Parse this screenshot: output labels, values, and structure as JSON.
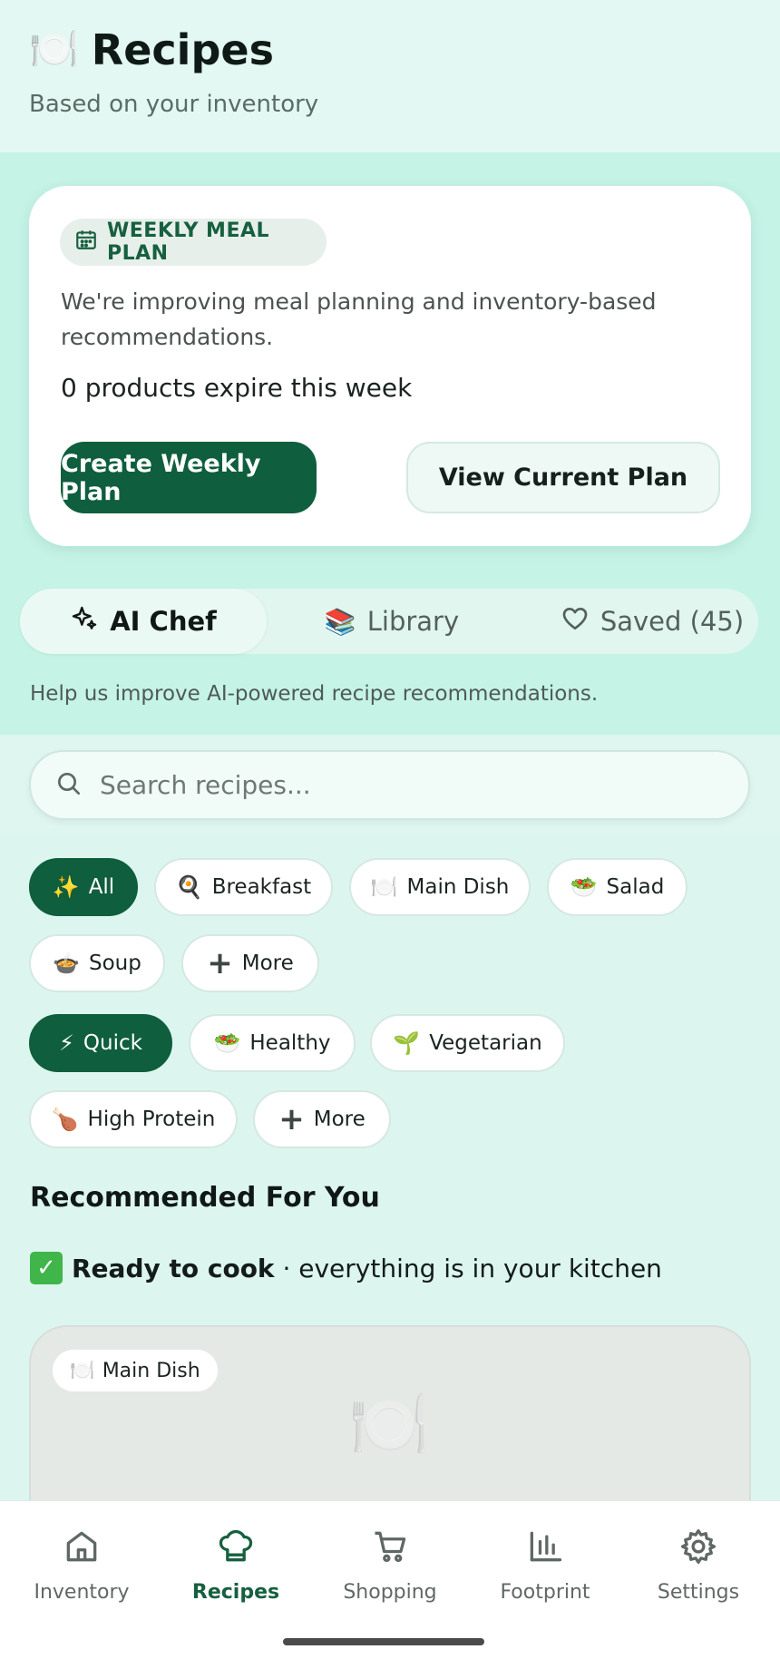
{
  "header": {
    "title": "Recipes",
    "title_icon": "plate-cutlery-icon",
    "subtitle": "Based on your inventory"
  },
  "meal_plan": {
    "badge_label": "WEEKLY MEAL PLAN",
    "badge_icon": "calendar-icon",
    "description": "We're improving meal planning and inventory-based recommendations.",
    "expire_text": "0 products expire this week",
    "create_label": "Create Weekly Plan",
    "view_label": "View Current Plan"
  },
  "tabs": [
    {
      "label": "AI Chef",
      "icon": "sparkle-icon",
      "active": true
    },
    {
      "label": "Library",
      "icon": "books-icon",
      "active": false
    },
    {
      "label": "Saved (45)",
      "icon": "heart-icon",
      "active": false
    }
  ],
  "help_text": "Help us improve AI-powered recipe recommendations.",
  "search": {
    "placeholder": "Search recipes..."
  },
  "category_chips": [
    {
      "label": "All",
      "emoji": "✨",
      "active": true
    },
    {
      "label": "Breakfast",
      "emoji": "🍳",
      "active": false
    },
    {
      "label": "Main Dish",
      "emoji": "🍽️",
      "active": false
    },
    {
      "label": "Salad",
      "emoji": "🥗",
      "active": false
    },
    {
      "label": "Soup",
      "emoji": "🍲",
      "active": false
    },
    {
      "label": "More",
      "emoji": "+",
      "active": false
    }
  ],
  "tag_chips": [
    {
      "label": "Quick",
      "emoji": "⚡",
      "active": true
    },
    {
      "label": "Healthy",
      "emoji": "🥗",
      "active": false
    },
    {
      "label": "Vegetarian",
      "emoji": "🌱",
      "active": false
    },
    {
      "label": "High Protein",
      "emoji": "🍗",
      "active": false
    },
    {
      "label": "More",
      "emoji": "+",
      "active": false
    }
  ],
  "recommended": {
    "title": "Recommended For You",
    "ready_bold": "Ready to cook",
    "ready_rest": " · everything is in your kitchen",
    "card_badge": "Main Dish",
    "card_badge_emoji": "🍽️"
  },
  "bottom_nav": [
    {
      "label": "Inventory",
      "icon": "home-icon",
      "active": false
    },
    {
      "label": "Recipes",
      "icon": "chef-hat-icon",
      "active": true
    },
    {
      "label": "Shopping",
      "icon": "cart-icon",
      "active": false
    },
    {
      "label": "Footprint",
      "icon": "bar-chart-icon",
      "active": false
    },
    {
      "label": "Settings",
      "icon": "gear-icon",
      "active": false
    }
  ],
  "colors": {
    "brand_green": "#0f5e3d",
    "background_mint": "#c5f3e6"
  }
}
